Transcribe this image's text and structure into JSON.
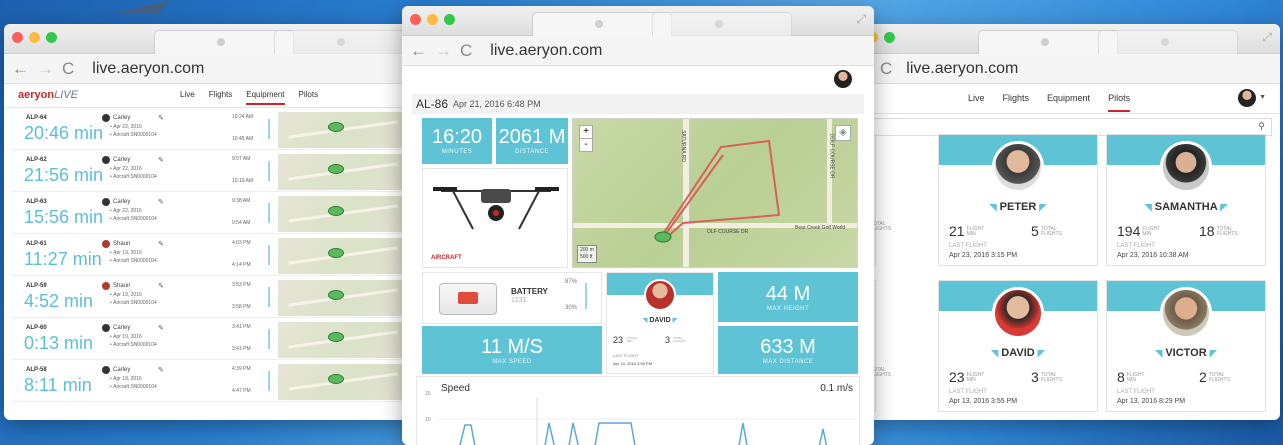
{
  "browser": {
    "url": "live.aeryon.com"
  },
  "left_window": {
    "logo": "aeryon",
    "logo_suffix": "LIVE",
    "nav": [
      "Live",
      "Flights",
      "Equipment",
      "Pilots"
    ],
    "active_nav": "Equipment",
    "flights": [
      {
        "id": "ALP-64",
        "duration": "20:46 min",
        "pilot": "Carley",
        "date": "Apr 22, 2016",
        "aircraft": "Aircraft SN0000104",
        "start": "10:24 AM",
        "end": "10:45 AM"
      },
      {
        "id": "ALP-62",
        "duration": "21:56 min",
        "pilot": "Carley",
        "date": "Apr 22, 2016",
        "aircraft": "Aircraft SN0000104",
        "start": "9:57 AM",
        "end": "10:19 AM"
      },
      {
        "id": "ALP-63",
        "duration": "15:56 min",
        "pilot": "Carley",
        "date": "Apr 22, 2016",
        "aircraft": "Aircraft SN0000104",
        "start": "9:38 AM",
        "end": "9:54 AM"
      },
      {
        "id": "ALP-61",
        "duration": "11:27 min",
        "pilot": "Shaun",
        "date": "Apr 19, 2016",
        "aircraft": "Aircraft SN0000104",
        "start": "4:03 PM",
        "end": "4:14 PM"
      },
      {
        "id": "ALP-59",
        "duration": "4:52 min",
        "pilot": "Shaun",
        "date": "Apr 19, 2016",
        "aircraft": "Aircraft SN0000104",
        "start": "3:53 PM",
        "end": "3:58 PM"
      },
      {
        "id": "ALP-60",
        "duration": "0:13 min",
        "pilot": "Carley",
        "date": "Apr 19, 2016",
        "aircraft": "Aircraft SN0000104",
        "start": "3:41 PM",
        "end": "3:41 PM"
      },
      {
        "id": "ALP-58",
        "duration": "8:11 min",
        "pilot": "Carley",
        "date": "Apr 18, 2016",
        "aircraft": "Aircraft SN0000104",
        "start": "4:39 PM",
        "end": "4:47 PM"
      }
    ]
  },
  "middle_window": {
    "flight_id": "AL-86",
    "flight_date": "Apr 21, 2016 6:48 PM",
    "minutes_value": "16:20",
    "minutes_label": "MINUTES",
    "distance_value": "2061 M",
    "distance_label": "DISTANCE",
    "aircraft_label": "AIRCRAFT",
    "map_labels": {
      "road1": "SATURNA RD",
      "road2": "GOLF COURSE DR",
      "road3": "OLF COURSE DR",
      "place": "Bear Creek Golf World",
      "scale_m": "200 m",
      "scale_ft": "500 ft"
    },
    "battery_label": "BATTERY",
    "battery_id": "1231",
    "battery_high": "87%",
    "battery_low": "30%",
    "pilot_name": "DAVID",
    "pilot_flight_min": "23",
    "pilot_flight_min_label": "FLIGHT MIN",
    "pilot_total_flights": "3",
    "pilot_total_flights_label": "TOTAL FLIGHTS",
    "pilot_last_flight_label": "LAST FLIGHT",
    "pilot_last_flight": "Apr 13, 2016 3:55 PM",
    "max_height_value": "44 M",
    "max_height_label": "MAX HEIGHT",
    "max_speed_value": "11 M/S",
    "max_speed_label": "MAX SPEED",
    "max_distance_value": "633 M",
    "max_distance_label": "MAX DISTANCE",
    "speed_title": "Speed",
    "speed_current": "0.1 m/s",
    "speed_ticks": [
      "15",
      "10"
    ]
  },
  "right_window": {
    "nav": [
      "Live",
      "Flights",
      "Equipment",
      "Pilots"
    ],
    "active_nav": "Pilots",
    "pilots": [
      {
        "name": "PETER",
        "flight_min": "21",
        "total_flights": "5",
        "last_flight": "Apr 23, 2016 3:15 PM"
      },
      {
        "name": "SAMANTHA",
        "flight_min": "194",
        "total_flights": "18",
        "last_flight": "Apr 23, 2016 10:38 AM"
      },
      {
        "name": "DAVID",
        "flight_min": "23",
        "total_flights": "3",
        "last_flight": "Apr 13, 2016 3:55 PM"
      },
      {
        "name": "VICTOR",
        "flight_min": "8",
        "total_flights": "2",
        "last_flight": "Apr 13, 2016 8:29 PM"
      }
    ],
    "flight_min_label": "FLIGHT MIN",
    "total_flights_label": "TOTAL FLIGHTS",
    "partial_label": "TOTAL FLIGHTS",
    "last_flight_label": "LAST FLIGHT"
  },
  "colors": {
    "accent": "#5ec4d5",
    "brand_red": "#c8262f"
  }
}
